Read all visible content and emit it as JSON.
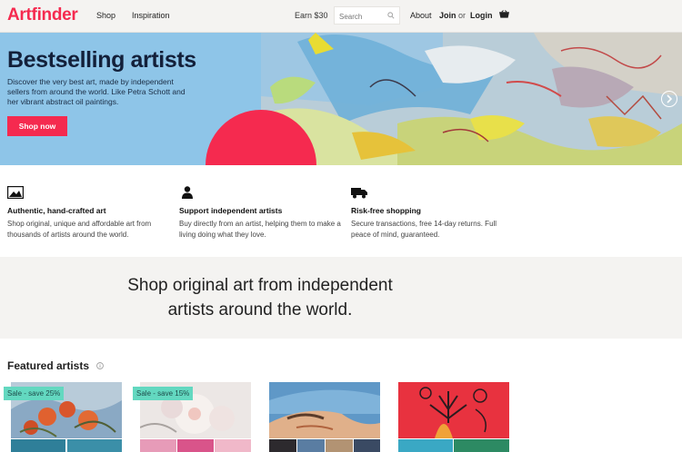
{
  "header": {
    "logo": "Artfinder",
    "nav": {
      "shop": "Shop",
      "inspiration": "Inspiration"
    },
    "earn": "Earn $30",
    "search_placeholder": "Search",
    "about": "About",
    "join": "Join",
    "or": "or",
    "login": "Login"
  },
  "hero": {
    "title": "Bestselling artists",
    "description": "Discover the very best art, made by independent sellers from around the world. Like Petra Schott and her vibrant abstract oil paintings.",
    "button": "Shop now"
  },
  "features": [
    {
      "icon": "image-icon",
      "title": "Authentic, hand-crafted art",
      "desc": "Shop original, unique and affordable art from thousands of artists around the world."
    },
    {
      "icon": "person-icon",
      "title": "Support independent artists",
      "desc": "Buy directly from an artist, helping them to make a living doing what they love."
    },
    {
      "icon": "truck-icon",
      "title": "Risk-free shopping",
      "desc": "Secure transactions, free 14-day returns. Full peace of mind, guaranteed."
    }
  ],
  "tagline": {
    "line1": "Shop original art from independent",
    "line2": "artists around the world."
  },
  "featured": {
    "title": "Featured artists",
    "badges": [
      "Sale - save 25%",
      "Sale - save 15%"
    ]
  },
  "colors": {
    "brand": "#f52a4f",
    "hero_bg": "#8ec5e8",
    "badge": "#63d8c0",
    "band": "#f4f3f1"
  }
}
